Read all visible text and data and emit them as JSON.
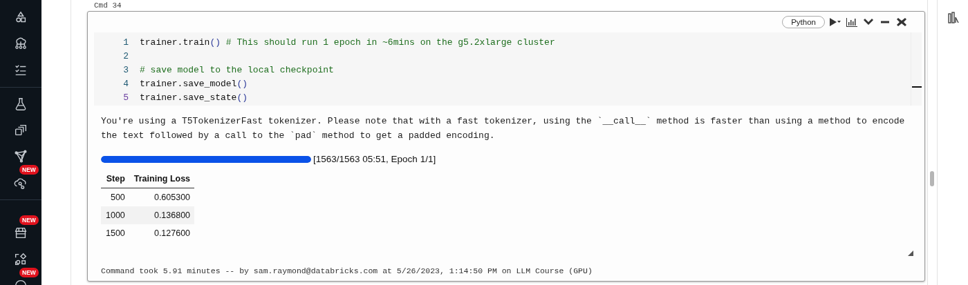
{
  "sidebar": {
    "groups": [
      {
        "items": [
          {
            "kind": "shapes"
          },
          {
            "kind": "cloud-tree"
          },
          {
            "kind": "checklist"
          }
        ]
      },
      {
        "items": [
          {
            "kind": "flask"
          },
          {
            "kind": "stack"
          },
          {
            "kind": "nodes"
          },
          {
            "kind": "cloud-link",
            "badge": "NEW"
          }
        ]
      },
      {
        "items": [
          {
            "kind": "store",
            "badge": "NEW"
          },
          {
            "kind": "shapes-diamond"
          },
          {
            "kind": "circle",
            "badge": "NEW"
          }
        ]
      }
    ]
  },
  "cell": {
    "label": "Cmd 34",
    "language": "Python",
    "code": [
      {
        "number": "1",
        "selected": false,
        "tokens": [
          {
            "kind": "code",
            "text": "trainer.train"
          },
          {
            "kind": "paren",
            "text": "()"
          },
          {
            "kind": "comment",
            "text": " # This should run 1 epoch in ~6mins on the g5.2xlarge cluster"
          }
        ]
      },
      {
        "number": "2",
        "selected": false
      },
      {
        "number": "3",
        "selected": false,
        "tokens": [
          {
            "kind": "comment",
            "text": "# save model to the local checkpoint"
          }
        ]
      },
      {
        "number": "4",
        "selected": false,
        "tokens": [
          {
            "kind": "code",
            "text": "trainer.save_model"
          },
          {
            "kind": "paren",
            "text": "()"
          }
        ]
      },
      {
        "number": "5",
        "selected": true,
        "tokens": [
          {
            "kind": "code",
            "text": "trainer.save_state"
          },
          {
            "kind": "paren",
            "text": "()"
          }
        ]
      }
    ],
    "output": {
      "message": "You're using a T5TokenizerFast tokenizer. Please note that with a fast tokenizer, using the `__call__` method is faster than using a method to encode the text followed by a call to the `pad` method to get a padded encoding.",
      "progress": {
        "level": 1,
        "reading": "[1563/1563 05:51, Epoch 1/1]"
      },
      "table": {
        "columns": [
          "Step",
          "Training Loss"
        ],
        "rows": [
          [
            "500",
            "0.605300"
          ],
          [
            "1000",
            "0.136800"
          ],
          [
            "1500",
            "0.127600"
          ]
        ]
      }
    },
    "footer": "Command took 5.91 minutes -- by sam.raymond@databricks.com at 5/26/2023, 1:14:50 PM on LLM Course (GPU)"
  }
}
